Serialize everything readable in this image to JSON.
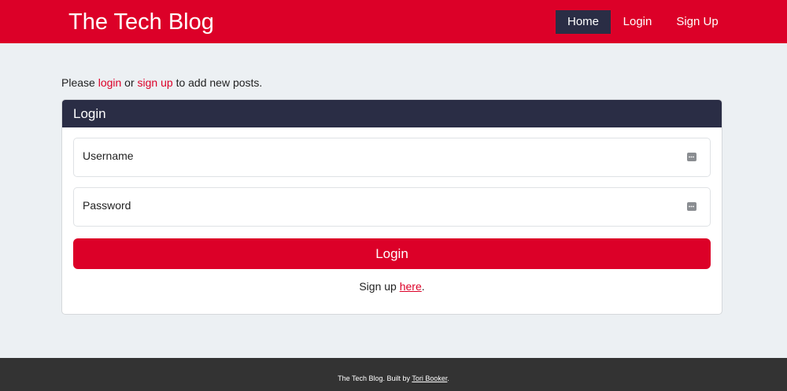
{
  "header": {
    "brand": "The Tech Blog",
    "nav": {
      "home": "Home",
      "login": "Login",
      "signup": "Sign Up"
    }
  },
  "intro": {
    "prefix": "Please ",
    "login_link": "login",
    "middle": " or ",
    "signup_link": "sign up",
    "suffix": " to add new posts."
  },
  "login_card": {
    "title": "Login",
    "username_placeholder": "Username",
    "password_placeholder": "Password",
    "submit_label": "Login",
    "signup_prefix": "Sign up ",
    "signup_link": "here",
    "signup_suffix": "."
  },
  "footer": {
    "prefix": "The Tech Blog. Built by ",
    "author": "Tori Booker",
    "suffix": "."
  },
  "colors": {
    "brand_red": "#dc0028",
    "navy": "#2a2d45",
    "page_bg": "#ecf0f3",
    "footer_bg": "#333333"
  },
  "icons": {
    "field_autofill": "password-manager-key-icon"
  }
}
